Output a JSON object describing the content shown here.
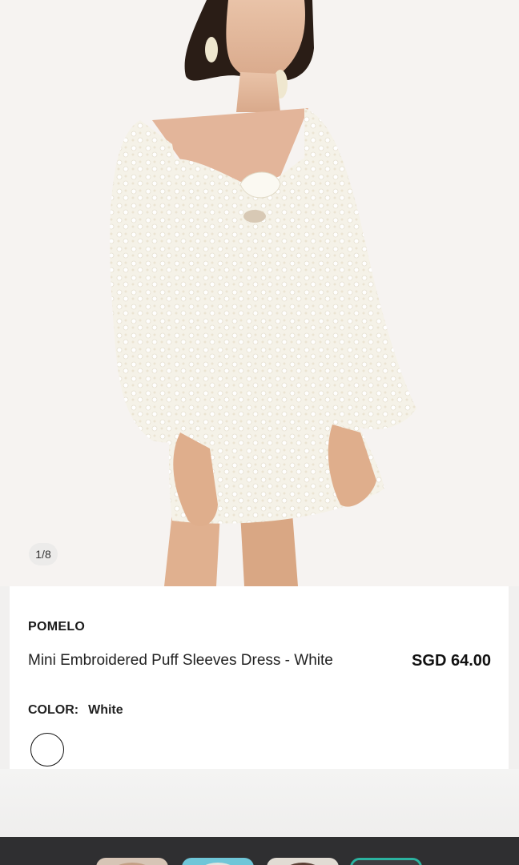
{
  "gallery": {
    "pager": "1/8"
  },
  "product": {
    "brand": "POMELO",
    "name": "Mini Embroidered Puff Sleeves Dress - White",
    "price": "SGD 64.00",
    "color_label": "COLOR:",
    "color_value": "White"
  },
  "colors": {
    "swatch": "#ffffff",
    "accent_thumb": "#2bb3a0"
  }
}
